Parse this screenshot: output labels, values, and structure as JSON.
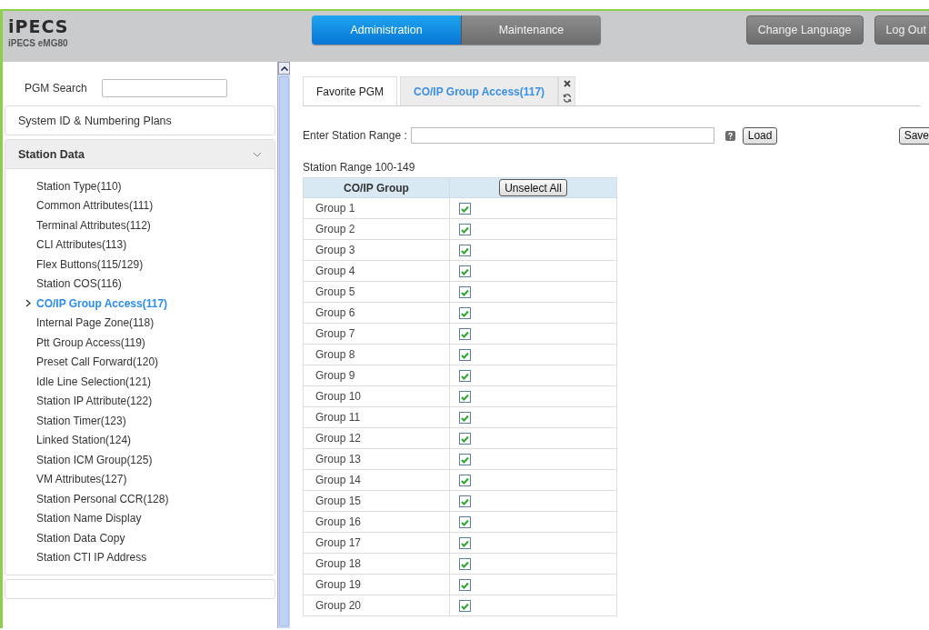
{
  "header": {
    "logo": "iPECS",
    "model": "iPECS eMG80",
    "nav": [
      {
        "label": "Administration",
        "selected": true
      },
      {
        "label": "Maintenance",
        "selected": false
      }
    ],
    "actions": [
      "Change Language",
      "Log Out"
    ]
  },
  "sidebar": {
    "search": {
      "label": "PGM Search"
    },
    "sections": [
      {
        "title": "System ID & Numbering Plans",
        "expanded": false
      },
      {
        "title": "Station Data",
        "expanded": true
      }
    ],
    "items": [
      {
        "label": "Station Type(110)",
        "selected": false
      },
      {
        "label": "Common Attributes(111)",
        "selected": false
      },
      {
        "label": "Terminal Attributes(112)",
        "selected": false
      },
      {
        "label": "CLI Attributes(113)",
        "selected": false
      },
      {
        "label": "Flex Buttons(115/129)",
        "selected": false
      },
      {
        "label": "Station COS(116)",
        "selected": false
      },
      {
        "label": "CO/IP Group Access(117)",
        "selected": true
      },
      {
        "label": "Internal Page Zone(118)",
        "selected": false
      },
      {
        "label": "Ptt Group Access(119)",
        "selected": false
      },
      {
        "label": "Preset Call Forward(120)",
        "selected": false
      },
      {
        "label": "Idle Line Selection(121)",
        "selected": false
      },
      {
        "label": "Station IP Attribute(122)",
        "selected": false
      },
      {
        "label": "Station Timer(123)",
        "selected": false
      },
      {
        "label": "Linked Station(124)",
        "selected": false
      },
      {
        "label": "Station ICM Group(125)",
        "selected": false
      },
      {
        "label": "VM Attributes(127)",
        "selected": false
      },
      {
        "label": "Station Personal CCR(128)",
        "selected": false
      },
      {
        "label": "Station Name Display",
        "selected": false
      },
      {
        "label": "Station Data Copy",
        "selected": false
      },
      {
        "label": "Station CTI IP Address",
        "selected": false
      }
    ]
  },
  "tabs": [
    {
      "label": "Favorite PGM",
      "selected": false
    },
    {
      "label": "CO/IP Group Access(117)",
      "selected": true
    }
  ],
  "range": {
    "label": "Enter Station Range :",
    "load": "Load",
    "save": "Save"
  },
  "range_caption": "Station Range 100-149",
  "table": {
    "columns": [
      "CO/IP Group"
    ],
    "unselect_all": "Unselect All",
    "rows": [
      {
        "group": "Group 1",
        "checked": true
      },
      {
        "group": "Group 2",
        "checked": true
      },
      {
        "group": "Group 3",
        "checked": true
      },
      {
        "group": "Group 4",
        "checked": true
      },
      {
        "group": "Group 5",
        "checked": true
      },
      {
        "group": "Group 6",
        "checked": true
      },
      {
        "group": "Group 7",
        "checked": true
      },
      {
        "group": "Group 8",
        "checked": true
      },
      {
        "group": "Group 9",
        "checked": true
      },
      {
        "group": "Group 10",
        "checked": true
      },
      {
        "group": "Group 11",
        "checked": true
      },
      {
        "group": "Group 12",
        "checked": true
      },
      {
        "group": "Group 13",
        "checked": true
      },
      {
        "group": "Group 14",
        "checked": true
      },
      {
        "group": "Group 15",
        "checked": true
      },
      {
        "group": "Group 16",
        "checked": true
      },
      {
        "group": "Group 17",
        "checked": true
      },
      {
        "group": "Group 18",
        "checked": true
      },
      {
        "group": "Group 19",
        "checked": true
      },
      {
        "group": "Group 20",
        "checked": true
      }
    ]
  }
}
